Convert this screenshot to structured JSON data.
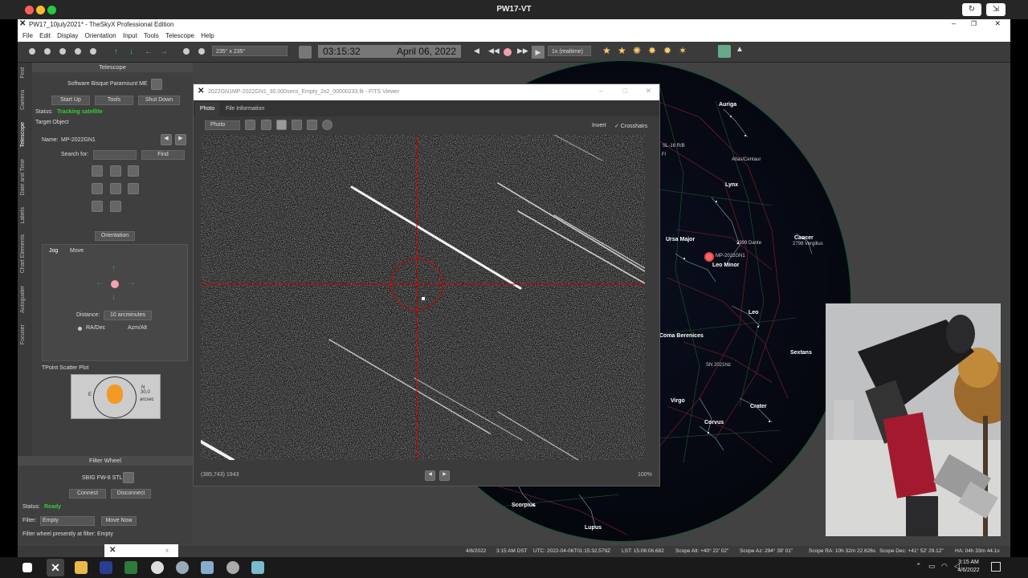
{
  "mac_title": "PW17-VT",
  "app_title": "PW17_10july2021* - TheSkyX Professional Edition",
  "menu": [
    "File",
    "Edit",
    "Display",
    "Orientation",
    "Input",
    "Tools",
    "Telescope",
    "Help"
  ],
  "toolbar": {
    "fov": "235° x 235°",
    "time": "03:15:32",
    "date": "April 06, 2022",
    "rate": "1x (realtime)"
  },
  "side_tabs": [
    "Find",
    "Camera",
    "Telescope",
    "Date and Time",
    "Labels",
    "Chart Elements",
    "Autoguider",
    "Focuser"
  ],
  "telescope": {
    "header": "Telescope",
    "mount": "Software Bisque Paramount ME",
    "startup": "Start Up",
    "tools": "Tools",
    "shutdown": "Shut Down",
    "status_label": "Status:",
    "status_value": "Tracking satellite",
    "target_object": "Target Object",
    "name_label": "Name:",
    "name_value": "MP-2022GN1",
    "search_label": "Search for:",
    "find": "Find",
    "orientation": "Orientation",
    "tab_jog": "Jog",
    "tab_move": "Move",
    "distance_label": "Distance:",
    "distance_value": "10 arcminutes",
    "radec": "RA/Dec",
    "azalt": "Azm/Alt",
    "tpoint": "TPoint Scatter Plot",
    "tp_e": "E",
    "tp_val": "30.0",
    "tp_unit": "arcsec",
    "tp_n": "N"
  },
  "filter": {
    "header": "Filter Wheel",
    "device": "SBIG FW-8 STL",
    "connect": "Connect",
    "disconnect": "Disconnect",
    "status_label": "Status:",
    "status_value": "Ready",
    "filter_label": "Filter:",
    "filter_value": "Empty",
    "move_now": "Move Now",
    "present": "Filter wheel presently at filter: Empty"
  },
  "fits": {
    "title": "2022GN1MP-2022GN1_30.000secs_Empty_2x2_00000233.fit - FITS Viewer",
    "tab_photo": "Photo",
    "tab_info": "File Information",
    "mode": "Photo",
    "invert": "Invert",
    "crosshairs": "✓ Crosshairs",
    "coord": "(385,743) 1943",
    "zoom": "100%"
  },
  "sky": {
    "constellations": [
      "Auriga",
      "Lynx",
      "Ursa Major",
      "Cancer",
      "Leo Minor",
      "Leo",
      "Sextans",
      "Coma Berenices",
      "Virgo",
      "Crater",
      "Corvus",
      "Scorpius",
      "Lupus"
    ],
    "stars": [
      "SL-16 R/B",
      "2999 Dante",
      "2798 Vergilius",
      "Atlas/Centaur",
      "MP-2022GN1",
      "SN 2021hlz",
      "R/B",
      "Fl"
    ]
  },
  "statusbar": {
    "date": "4/6/2022",
    "time": "3:15 AM DST",
    "utc": "UTC: 2022-04-06T01:15:32.579Z",
    "lst": "LST: 15:06:06.682",
    "alt": "Scope Alt: +40° 22' 02\"",
    "az": "Scope Az: 294° 39' 01\"",
    "ra": "Scope RA: 10h 32m 22.626s",
    "dec": "Scope Dec: +41° 52' 29.12\"",
    "ha": "HA: 04h 33m 44.1s"
  },
  "popup": "x",
  "clock": {
    "time": "3:15 AM",
    "date": "4/6/2022"
  },
  "colors": {
    "green_status": "#33cc33",
    "crosshair": "#cc0000",
    "dialog_bg": "#3b3b3b"
  }
}
